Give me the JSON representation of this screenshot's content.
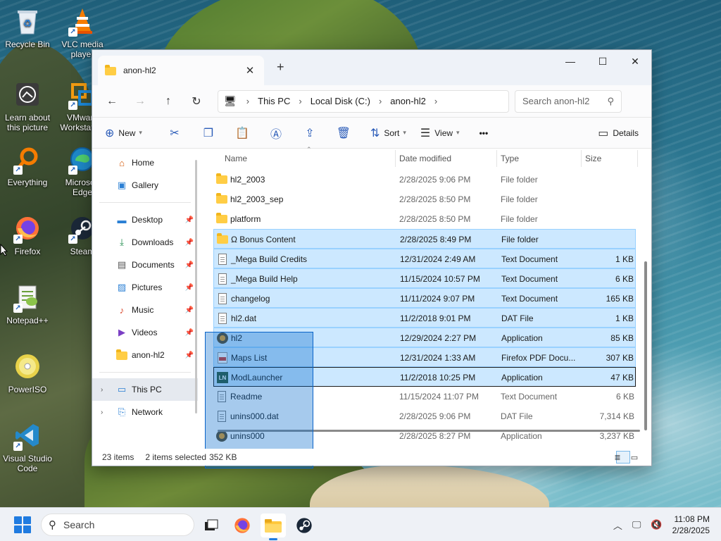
{
  "desktop": {
    "icons": [
      {
        "label": "Recycle Bin",
        "icon": "recycle-bin-icon"
      },
      {
        "label": "VLC media player",
        "icon": "vlc-icon"
      },
      {
        "label": "Learn about this picture",
        "icon": "learn-about-picture-icon"
      },
      {
        "label": "VMware Workstation",
        "icon": "vmware-icon"
      },
      {
        "label": "Everything",
        "icon": "everything-search-icon"
      },
      {
        "label": "Microsoft Edge",
        "icon": "edge-icon"
      },
      {
        "label": "Firefox",
        "icon": "firefox-icon"
      },
      {
        "label": "Steam",
        "icon": "steam-icon"
      },
      {
        "label": "Notepad++",
        "icon": "notepad-plus-plus-icon"
      },
      {
        "label": "PowerISO",
        "icon": "poweriso-icon"
      },
      {
        "label": "Visual Studio Code",
        "icon": "vscode-icon"
      }
    ]
  },
  "window": {
    "tab_title": "anon-hl2",
    "new_tab": "+",
    "controls": {
      "minimize": "—",
      "maximize": "☐",
      "close": "✕"
    }
  },
  "navbar": {
    "breadcrumbs": [
      "This PC",
      "Local Disk (C:)",
      "anon-hl2"
    ],
    "search_placeholder": "Search anon-hl2"
  },
  "toolbar": {
    "new_label": "New",
    "sort_label": "Sort",
    "view_label": "View",
    "more_label": "•••",
    "details_label": "Details"
  },
  "navpane": {
    "quick": [
      {
        "label": "Home",
        "icon": "home-icon"
      },
      {
        "label": "Gallery",
        "icon": "gallery-icon"
      }
    ],
    "pinned": [
      {
        "label": "Desktop",
        "icon": "desktop-icon"
      },
      {
        "label": "Downloads",
        "icon": "downloads-icon"
      },
      {
        "label": "Documents",
        "icon": "documents-icon"
      },
      {
        "label": "Pictures",
        "icon": "pictures-icon"
      },
      {
        "label": "Music",
        "icon": "music-icon"
      },
      {
        "label": "Videos",
        "icon": "videos-icon"
      },
      {
        "label": "anon-hl2",
        "icon": "folder-icon"
      }
    ],
    "tree": [
      {
        "label": "This PC",
        "icon": "this-pc-icon"
      },
      {
        "label": "Network",
        "icon": "network-icon"
      }
    ]
  },
  "columns": {
    "name": "Name",
    "date": "Date modified",
    "type": "Type",
    "size": "Size"
  },
  "files": [
    {
      "name": "hl2_2003",
      "date": "2/28/2025 9:06 PM",
      "type": "File folder",
      "size": "",
      "kind": "folder",
      "selected": false
    },
    {
      "name": "hl2_2003_sep",
      "date": "2/28/2025 8:50 PM",
      "type": "File folder",
      "size": "",
      "kind": "folder",
      "selected": false
    },
    {
      "name": "platform",
      "date": "2/28/2025 8:50 PM",
      "type": "File folder",
      "size": "",
      "kind": "folder",
      "selected": false
    },
    {
      "name": "Ω Bonus Content",
      "date": "2/28/2025 8:49 PM",
      "type": "File folder",
      "size": "",
      "kind": "folder",
      "selected": true
    },
    {
      "name": "_Mega Build Credits",
      "date": "12/31/2024 2:49 AM",
      "type": "Text Document",
      "size": "1 KB",
      "kind": "doc",
      "selected": true
    },
    {
      "name": "_Mega Build Help",
      "date": "11/15/2024 10:57 PM",
      "type": "Text Document",
      "size": "6 KB",
      "kind": "doc",
      "selected": true
    },
    {
      "name": "changelog",
      "date": "11/11/2024 9:07 PM",
      "type": "Text Document",
      "size": "165 KB",
      "kind": "doc",
      "selected": true
    },
    {
      "name": "hl2.dat",
      "date": "11/2/2018 9:01 PM",
      "type": "DAT File",
      "size": "1 KB",
      "kind": "doc",
      "selected": true
    },
    {
      "name": "hl2",
      "date": "12/29/2024 2:27 PM",
      "type": "Application",
      "size": "85 KB",
      "kind": "app",
      "selected": true
    },
    {
      "name": "Maps List",
      "date": "12/31/2024 1:33 AM",
      "type": "Firefox PDF Docu...",
      "size": "307 KB",
      "kind": "pdf",
      "selected": true
    },
    {
      "name": "ModLauncher",
      "date": "11/2/2018 10:25 PM",
      "type": "Application",
      "size": "47 KB",
      "kind": "ml",
      "selected": true
    },
    {
      "name": "Readme",
      "date": "11/15/2024 11:07 PM",
      "type": "Text Document",
      "size": "6 KB",
      "kind": "doc",
      "selected": false
    },
    {
      "name": "unins000.dat",
      "date": "2/28/2025 9:06 PM",
      "type": "DAT File",
      "size": "7,314 KB",
      "kind": "doc",
      "selected": false
    },
    {
      "name": "unins000",
      "date": "2/28/2025 8:27 PM",
      "type": "Application",
      "size": "3,237 KB",
      "kind": "app",
      "selected": false
    }
  ],
  "status": {
    "item_count": "23 items",
    "selection": "2 items selected",
    "selection_size": "352 KB"
  },
  "taskbar": {
    "search_placeholder": "Search",
    "time": "11:08 PM",
    "date": "2/28/2025"
  }
}
